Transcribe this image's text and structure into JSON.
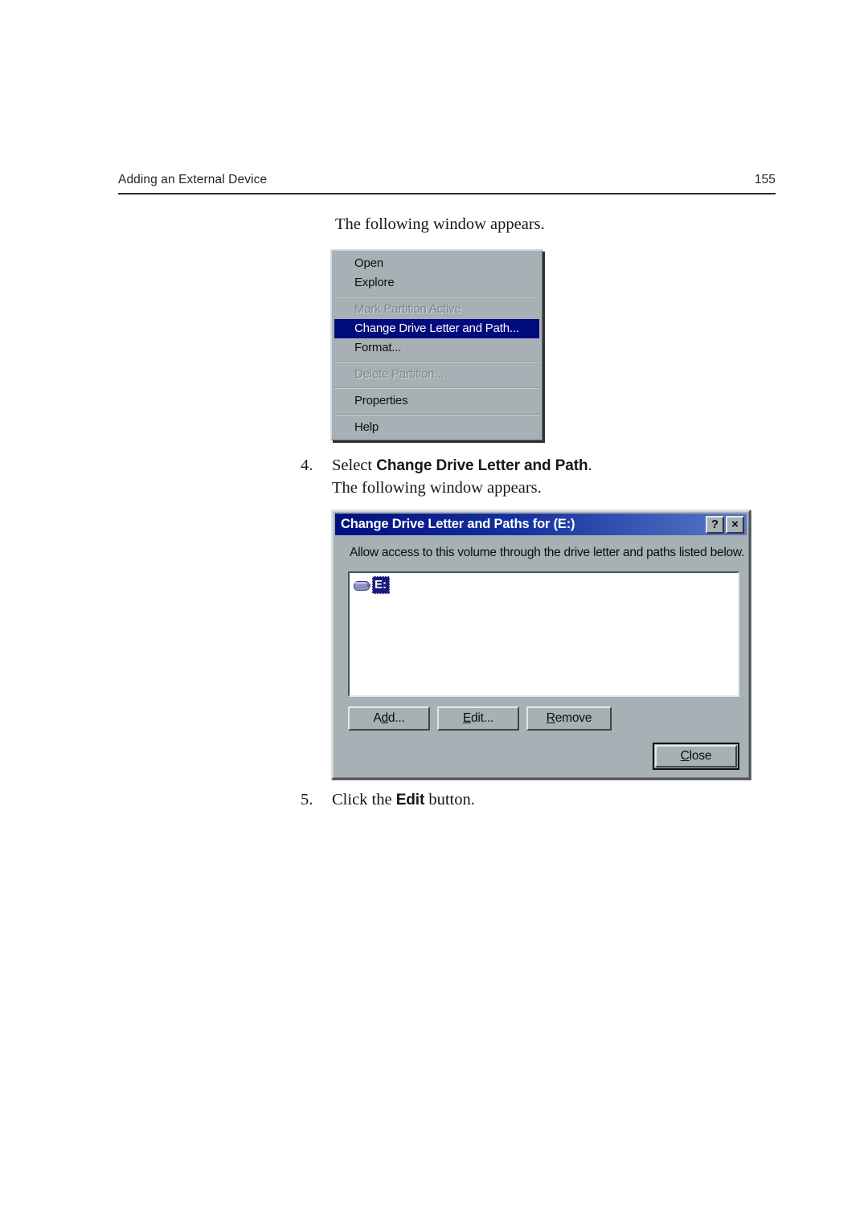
{
  "page": {
    "running_head": "Adding an External Device",
    "page_number": "155"
  },
  "body": {
    "intro_line": "The following window appears.",
    "steps": [
      {
        "number": "4.",
        "lead": "Select ",
        "bold": "Change Drive Letter and Path",
        "trail": ".",
        "sub_line": "The following window appears."
      },
      {
        "number": "5.",
        "lead": "Click the ",
        "bold": "Edit",
        "trail": " button.",
        "sub_line": ""
      }
    ]
  },
  "context_menu": {
    "items": [
      {
        "label": "Open",
        "state": "normal"
      },
      {
        "label": "Explore",
        "state": "normal"
      },
      {
        "label": "Mark Partition Active",
        "state": "disabled"
      },
      {
        "label": "Change Drive Letter and Path...",
        "state": "selected"
      },
      {
        "label": "Format...",
        "state": "normal"
      },
      {
        "label": "Delete Partition...",
        "state": "disabled"
      },
      {
        "label": "Properties",
        "state": "normal"
      },
      {
        "label": "Help",
        "state": "normal"
      }
    ],
    "highlight_color": "#000b7d",
    "face_color": "#a7b0b4"
  },
  "dialog": {
    "title": "Change Drive Letter and Paths for  (E:)",
    "title_bar_buttons": [
      {
        "name": "help-button",
        "glyph": "?"
      },
      {
        "name": "close-button",
        "glyph": "×"
      }
    ],
    "instruction": "Allow access to this volume through the drive letter and paths listed below.",
    "list_items": [
      {
        "icon": "drive-icon",
        "label": "E:",
        "selected": true
      }
    ],
    "buttons": {
      "add": {
        "pre": "A",
        "accel": "d",
        "post": "d..."
      },
      "edit": {
        "pre": "",
        "accel": "E",
        "post": "dit..."
      },
      "remove": {
        "pre": "",
        "accel": "R",
        "post": "emove"
      },
      "close": {
        "pre": "",
        "accel": "C",
        "post": "lose"
      }
    },
    "titlebar_gradient_start": "#000f7e",
    "titlebar_gradient_end": "#5a78c8",
    "face_color": "#a7b0b4"
  }
}
